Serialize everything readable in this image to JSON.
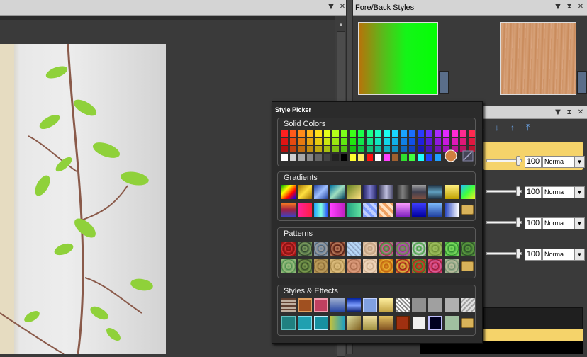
{
  "fore_back": {
    "title": "Fore/Back Styles"
  },
  "layers_panel": {
    "rows": [
      {
        "opacity": "100",
        "blend": "Norma"
      },
      {
        "opacity": "100",
        "blend": "Norma"
      },
      {
        "opacity": "100",
        "blend": "Norma"
      },
      {
        "opacity": "100",
        "blend": "Norma"
      }
    ]
  },
  "style_picker": {
    "title": "Style Picker",
    "solid_colors_label": "Solid Colors",
    "gradients_label": "Gradients",
    "patterns_label": "Patterns",
    "styles_effects_label": "Styles & Effects"
  },
  "colors": {
    "accent_yellow": "#f5d36a",
    "panel_bg": "#3a3a3a",
    "title_bar": "#d4d4d4"
  }
}
